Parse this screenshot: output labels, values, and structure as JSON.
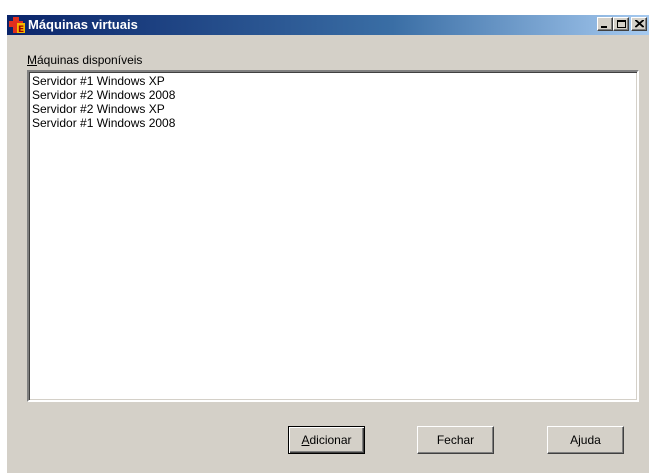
{
  "window": {
    "title": "Máquinas virtuais",
    "app_icon": "app-cross-e-icon",
    "caption_buttons": [
      "minimize-icon",
      "maximize-icon",
      "close-icon"
    ]
  },
  "list": {
    "label_accelerator": "M",
    "label_rest": "áquinas disponíveis",
    "items": [
      "Servidor #1 Windows XP",
      "Servidor #2 Windows 2008",
      "Servidor #2 Windows XP",
      "Servidor #1 Windows 2008"
    ]
  },
  "buttons": {
    "add_accelerator": "A",
    "add_rest": "dicionar",
    "close_label": "Fechar",
    "help_label": "Ajuda"
  },
  "colors": {
    "titlebar_start": "#0a246a",
    "titlebar_end": "#a6caf0",
    "face": "#d4d0c8"
  }
}
